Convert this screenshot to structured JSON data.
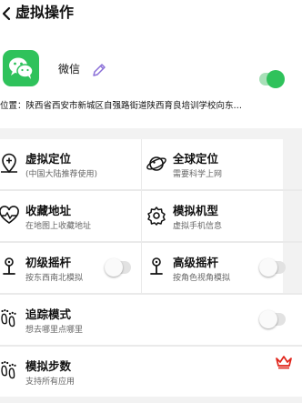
{
  "header": {
    "title": "虚拟操作",
    "back_icon": "chevron-left-icon"
  },
  "app": {
    "name": "微信",
    "icon": "wechat-icon",
    "edit_icon": "pencil-icon",
    "enabled": true,
    "location": "位置：陕西省西安市新城区自强路街道陕西育良培训学校向东…"
  },
  "features": [
    {
      "title": "虚拟定位",
      "subtitle": "(中国大陆推荐使用)",
      "icon": "location-pin-icon"
    },
    {
      "title": "全球定位",
      "subtitle": "需要科学上网",
      "icon": "planet-icon"
    },
    {
      "title": "收藏地址",
      "subtitle": "在地图上收藏地址",
      "icon": "heart-pulse-icon"
    },
    {
      "title": "模拟机型",
      "subtitle": "虚拟手机信息",
      "icon": "gear-icon"
    },
    {
      "title": "初级摇杆",
      "subtitle": "按东西南北模拟",
      "icon": "joystick-icon",
      "toggle": false
    },
    {
      "title": "高级摇杆",
      "subtitle": "按角色视角模拟",
      "icon": "joystick-icon",
      "toggle": false
    },
    {
      "title": "追踪模式",
      "subtitle": "想去哪里点哪里",
      "icon": "footprints-icon",
      "toggle": false
    },
    {
      "title": "模拟步数",
      "subtitle": "支持所有应用",
      "icon": "footprints-icon",
      "premium_icon": "crown-icon"
    }
  ],
  "colors": {
    "accent": "#2fc25b",
    "crown": "#e0251b",
    "pencil": "#8a6fd8"
  }
}
